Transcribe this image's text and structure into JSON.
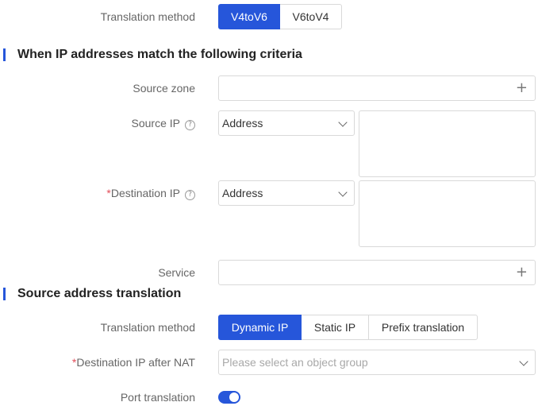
{
  "translation": {
    "label": "Translation method",
    "options": [
      "V4toV6",
      "V6toV4"
    ],
    "selected": "V4toV6"
  },
  "criteria_section": {
    "title": "When IP addresses match the following criteria"
  },
  "source_zone": {
    "label": "Source zone",
    "add_icon": "plus-icon"
  },
  "source_ip": {
    "label": "Source IP",
    "help_glyph": "?",
    "type_value": "Address",
    "help_icon": "question-circle-icon"
  },
  "destination_ip": {
    "required_mark": "*",
    "label": "Destination IP",
    "help_glyph": "?",
    "type_value": "Address",
    "help_icon": "question-circle-icon"
  },
  "service": {
    "label": "Service",
    "add_icon": "plus-icon"
  },
  "source_translation_section": {
    "title": "Source address translation"
  },
  "sat_method": {
    "label": "Translation method",
    "options": [
      "Dynamic IP",
      "Static IP",
      "Prefix translation"
    ],
    "selected": "Dynamic IP"
  },
  "dest_ip_after_nat": {
    "required_mark": "*",
    "label": "Destination IP after NAT",
    "placeholder": "Please select an object group"
  },
  "port_translation": {
    "label": "Port translation",
    "enabled": true
  },
  "colors": {
    "accent": "#2656da",
    "required": "#e34d59",
    "border": "#d9d9d9"
  }
}
